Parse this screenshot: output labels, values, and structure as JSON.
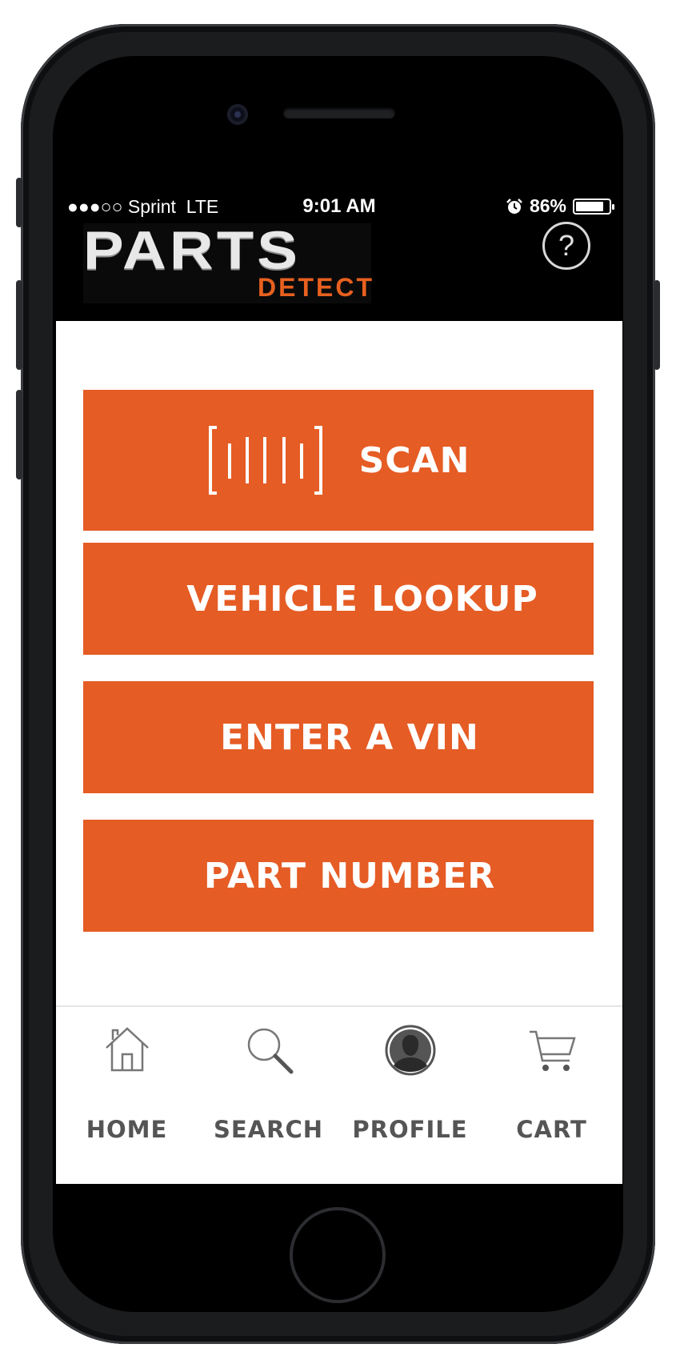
{
  "status_bar": {
    "signal": "●●●○○",
    "carrier": "Sprint",
    "network": "LTE",
    "time": "9:01 AM",
    "battery_percent": "86%",
    "battery_level": 0.86
  },
  "header": {
    "logo_main": "PARTS",
    "logo_sub": "DETECT",
    "help_symbol": "?",
    "help_icon": "question-circle-icon"
  },
  "actions": [
    {
      "label": "SCAN",
      "icon": "barcode-scan-icon"
    },
    {
      "label": "VEHICLE LOOKUP"
    },
    {
      "label": "ENTER A VIN"
    },
    {
      "label": "PART NUMBER"
    }
  ],
  "tab_bar": [
    {
      "label": "HOME",
      "icon": "home-icon"
    },
    {
      "label": "SEARCH",
      "icon": "search-icon"
    },
    {
      "label": "PROFILE",
      "icon": "profile-icon"
    },
    {
      "label": "CART",
      "icon": "cart-icon"
    }
  ],
  "colors": {
    "accent": "#e55c25",
    "header_bg": "#000000",
    "tab_text": "#555555",
    "logo_detect": "#e8601f"
  }
}
